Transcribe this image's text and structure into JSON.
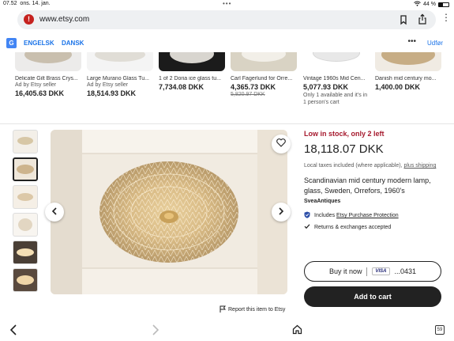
{
  "status_bar": {
    "time": "07.52",
    "date": "ons. 14. jan.",
    "battery": "44 %",
    "battery_level": 0.44,
    "dots": "•••"
  },
  "browser": {
    "url": "www.etsy.com",
    "site_warning_icon": "warning-icon",
    "menu": "⋮"
  },
  "translate_bar": {
    "icon": "google-translate-icon",
    "lang1": "ENGELSK",
    "lang2": "DANSK",
    "more": "•••",
    "done": "Udfør"
  },
  "recommendations": [
    {
      "title": "Delicate Gilt Brass Crys...",
      "ad": "Ad by Etsy seller",
      "price": "16,405.63 DKK"
    },
    {
      "title": "Large Murano Glass Tu...",
      "ad": "Ad by Etsy seller",
      "price": "18,514.93 DKK"
    },
    {
      "title": "1 of 2 Doria ice glass tu...",
      "price": "7,734.08 DKK"
    },
    {
      "title": "Carl Fagerlund for Orre...",
      "price": "4,365.73 DKK",
      "original_price": "5,820.97 DKK"
    },
    {
      "title": "Vintage 1960s Mid Cen...",
      "price": "5,077.93 DKK",
      "note": "Only 1 available and it's in 1 person's cart"
    },
    {
      "title": "Danish mid century mo...",
      "price": "1,400.00 DKK"
    }
  ],
  "product": {
    "stock": "Low in stock, only 2 left",
    "price": "18,118.07 DKK",
    "tax_text": "Local taxes included (where applicable),",
    "tax_link": "plus shipping",
    "title": "Scandinavian mid century modern lamp, glass, Sweden, Orrefors, 1960's",
    "shop": "SveaAntiques",
    "feature1_prefix": "Includes",
    "feature1_link": "Etsy Purchase Protection",
    "feature2": "Returns & exchanges accepted",
    "buy_now": "Buy it now",
    "card_brand": "VISA",
    "card_last": "...0431",
    "add_to_cart": "Add to cart",
    "report": "Report this item to Etsy"
  },
  "toolbar": {
    "tab_count": "59"
  },
  "colors": {
    "stock_red": "#a61a2e",
    "link_blue": "#1a73e8",
    "button_dark": "#222222"
  }
}
